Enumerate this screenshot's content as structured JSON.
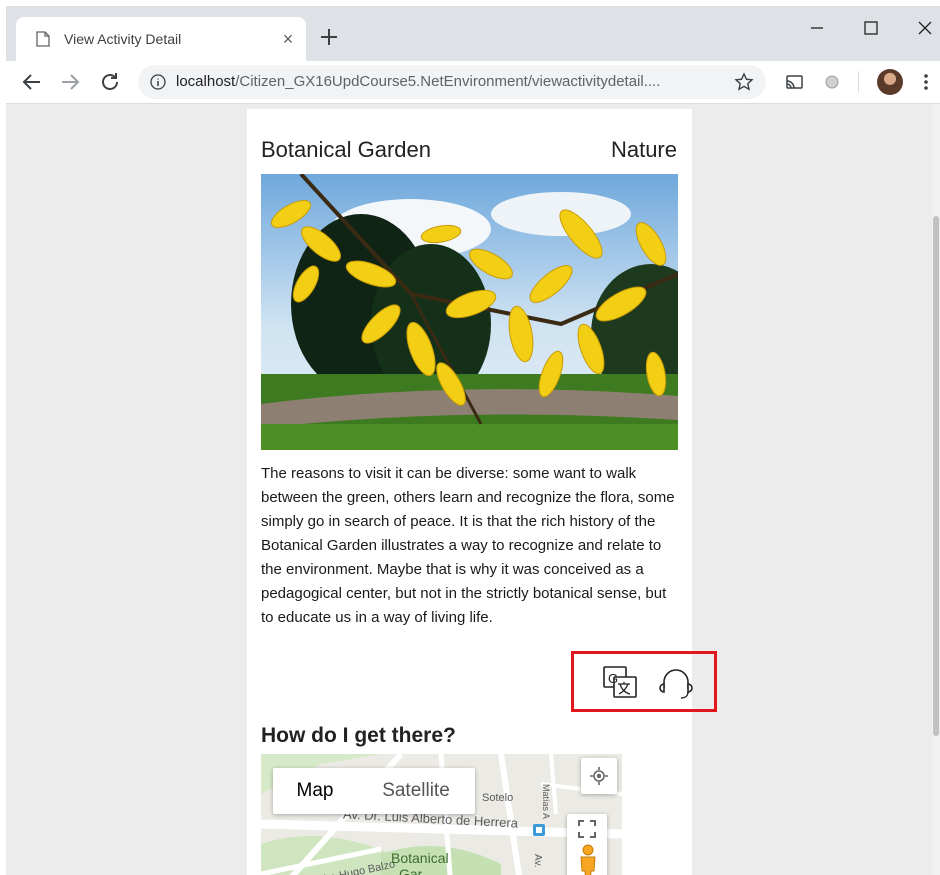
{
  "browser": {
    "tab_title": "View Activity Detail",
    "tab_close": "×",
    "url_host": "localhost",
    "url_path": "/Citizen_GX16UpdCourse5.NetEnvironment/viewactivitydetail...."
  },
  "activity": {
    "title": "Botanical Garden",
    "category": "Nature",
    "description": "The reasons to visit it can be diverse: some want to walk between the green, others learn and recognize the flora, some simply go in search of peace. It is that the rich history of the Botanical Garden illustrates a way to recognize and relate to the environment. Maybe that is why it was conceived as a pedagogical center, but not in the strictly botanical sense, but to educate us in a way of living life.",
    "photo_icon": "yellow-leaves-photo",
    "actions": [
      {
        "icon": "translate-icon"
      },
      {
        "icon": "headphones-icon"
      }
    ]
  },
  "directions": {
    "heading": "How do I get there?",
    "map": {
      "tabs": [
        "Map",
        "Satellite"
      ],
      "active_tab": "Map",
      "labels": {
        "street_main": "Av. Dr. Luis Alberto de Herrera",
        "street_sotelo": "Sotelo",
        "street_hugo": "Av. Hugo Balzo",
        "place": "Botanical",
        "place2": "Gar",
        "street_vertical": "Matías A",
        "street_av": "Av."
      }
    }
  },
  "colors": {
    "highlight": "#e3151f",
    "chrome_bg": "#dee1e6",
    "page_bg": "#ececec"
  }
}
